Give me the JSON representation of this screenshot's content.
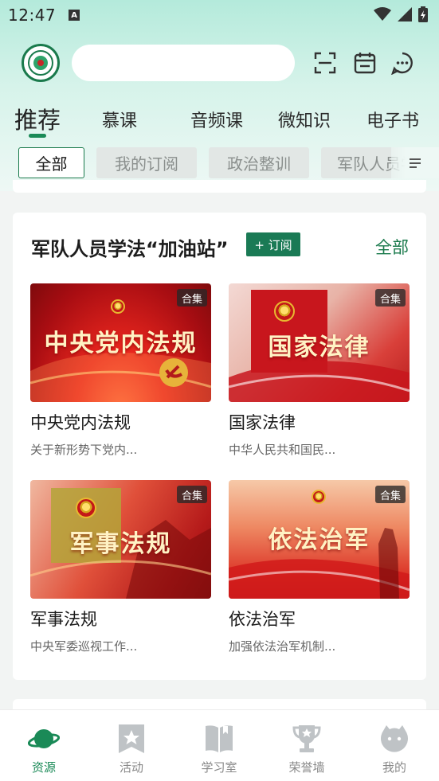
{
  "status_bar": {
    "time": "12:47",
    "notification_icon": "A"
  },
  "header": {
    "search_placeholder": "",
    "icons": [
      "scan-icon",
      "calendar-icon",
      "message-icon"
    ]
  },
  "tabs": [
    {
      "label": "推荐",
      "active": true
    },
    {
      "label": "慕课"
    },
    {
      "label": "音频课"
    },
    {
      "label": "微知识"
    },
    {
      "label": "电子书"
    }
  ],
  "chips": [
    {
      "label": "全部",
      "active": true
    },
    {
      "label": "我的订阅"
    },
    {
      "label": "政治整训"
    },
    {
      "label": "军队人员学法"
    }
  ],
  "section": {
    "title": "军队人员学法“加油站”",
    "subscribe_label": "+ 订阅",
    "all_label": "全部",
    "items": [
      {
        "cover_text": "中央党内法规",
        "badge": "合集",
        "name": "中央党内法规",
        "desc": "关于新形势下党内..."
      },
      {
        "cover_text": "国家法律",
        "badge": "合集",
        "name": "国家法律",
        "desc": "中华人民共和国民..."
      },
      {
        "cover_text": "军事法规",
        "badge": "合集",
        "name": "军事法规",
        "desc": "中央军委巡视工作..."
      },
      {
        "cover_text": "依法治军",
        "badge": "合集",
        "name": "依法治军",
        "desc": "加强依法治军机制..."
      }
    ]
  },
  "bottom_nav": [
    {
      "label": "资源",
      "icon": "planet-icon",
      "active": true
    },
    {
      "label": "活动",
      "icon": "bookmark-star-icon"
    },
    {
      "label": "学习室",
      "icon": "book-icon"
    },
    {
      "label": "荣誉墙",
      "icon": "trophy-icon"
    },
    {
      "label": "我的",
      "icon": "profile-icon"
    }
  ],
  "colors": {
    "accent": "#1a8a57",
    "brand_dark": "#1a7a55"
  }
}
